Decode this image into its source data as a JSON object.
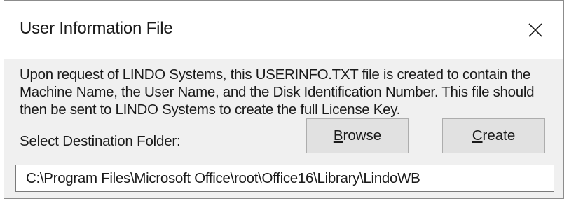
{
  "dialog": {
    "title": "User Information File",
    "close_icon": "close-icon",
    "message": "Upon request of LINDO Systems, this USERINFO.TXT file is created to contain the Machine Name, the User Name, and the Disk Identification Number. This file should then be sent to LINDO Systems to create the full License Key.",
    "destination_label": "Select Destination Folder:",
    "browse_button": {
      "mnemonic": "B",
      "rest": "rowse"
    },
    "create_button": {
      "mnemonic": "C",
      "rest": "reate"
    },
    "destination_path": "C:\\Program Files\\Microsoft Office\\root\\Office16\\Library\\LindoWB"
  },
  "colors": {
    "title_bar": "#ffffff",
    "dialog_body": "#f0f0f0",
    "button_face": "#e1e1e1",
    "button_border": "#adadad",
    "text": "#1a1a1a"
  }
}
